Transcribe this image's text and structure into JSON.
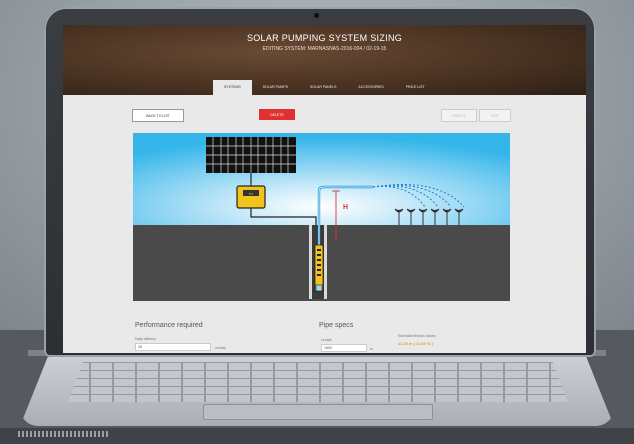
{
  "app": {
    "title": "SOLAR PUMPING SYSTEM SIZING",
    "subtitle": "EDITING SYSTEM: MARNASNAS-2016-004 / 02-19-15"
  },
  "tabs": [
    {
      "label": "SYSTEMS",
      "active": true
    },
    {
      "label": "SOLAR PUMPS",
      "active": false
    },
    {
      "label": "SOLAR PANELS",
      "active": false
    },
    {
      "label": "ACCESSORIES",
      "active": false
    },
    {
      "label": "PRICE LIST",
      "active": false
    }
  ],
  "toolbar": {
    "back_label": "BACK TO LIST",
    "delete_label": "DELETE",
    "create_label": "CREATE",
    "edit_label": "EDIT"
  },
  "diagram": {
    "height_marker": "H",
    "controller_label": "▪▪▪"
  },
  "performance": {
    "heading": "Performance required",
    "daily_delivery_label": "Daily delivery",
    "daily_delivery_value": "28",
    "daily_delivery_unit": "m³/day"
  },
  "pipe": {
    "heading": "Pipe specs",
    "length_label": "Length",
    "length_value": "1600",
    "length_unit": "m",
    "friction_label": "Estimated friction losses",
    "friction_value": "11.25 m ( 11.60 % )"
  },
  "colors": {
    "accent_red": "#e03030",
    "sky_blue": "#35b6ea",
    "ground": "#4a4a4a",
    "controller_yellow": "#f2c31b",
    "friction_orange": "#e39a12"
  }
}
